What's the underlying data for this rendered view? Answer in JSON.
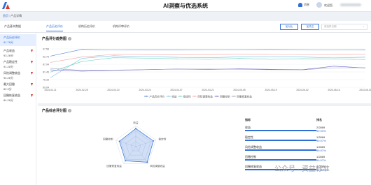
{
  "header": {
    "title": "AI洞察与优选系统",
    "notice_label": "消息",
    "welcome_label": "欢迎您,"
  },
  "breadcrumb": [
    "首页",
    "产品详情"
  ],
  "tabs": [
    "产品基本数据",
    "产品历史评价",
    "机构历史评价",
    "机构评审评价"
  ],
  "actions": {
    "btn_a": "加对比",
    "btn_b": "加关注",
    "select_placeholder": "请选择日期"
  },
  "left_list": [
    {
      "name": "产品历史评价",
      "value": "91.76分"
    },
    {
      "name": "产品收益",
      "value": "93.26分"
    },
    {
      "name": "产品稳定性",
      "value": "91.28分"
    },
    {
      "name": "风险调整收益",
      "value": "94.26分"
    },
    {
      "name": "最大回撤",
      "value": "82.3分"
    },
    {
      "name": "回撤恢复收益",
      "value": "84.26分"
    }
  ],
  "trend": {
    "heading": "产品评分趋势图",
    "help": "?",
    "colors": {
      "a": "#4a7bd0",
      "b": "#76c2e8",
      "c": "#62d0b5",
      "d": "#f4a0a0",
      "e": "#6a60c8",
      "f": "#9aa3b5"
    }
  },
  "chart_data": {
    "type": "line",
    "x": [
      "2024-02-11",
      "2024-02-25",
      "2024-03-10",
      "2024-03-24",
      "2024-04-07",
      "2024-04-21",
      "2024-05-05",
      "2024-05-19",
      "2024-06-02",
      "2024-06-16",
      "2024-06-30"
    ],
    "ylim": [
      69.04,
      97.58
    ],
    "yticks": [
      "97.58",
      "92.75",
      "87.94",
      "81.45",
      "76.33",
      "69.04"
    ],
    "series": [
      {
        "name": "产品历史评价",
        "values": [
          92.2,
          97.2,
          96.8,
          96.9,
          96.9,
          97.0,
          97.0,
          97.1,
          97.0,
          96.8,
          96.9
        ]
      },
      {
        "name": "收益",
        "values": [
          76.2,
          90.5,
          92.5,
          91.8,
          91.3,
          91.0,
          91.6,
          91.7,
          91.5,
          90.9,
          91.4
        ]
      },
      {
        "name": "稳定性",
        "values": [
          80.3,
          88.2,
          91.0,
          90.7,
          90.2,
          89.8,
          90.5,
          89.8,
          90.3,
          90.0,
          89.7
        ]
      },
      {
        "name": "风险调整收益",
        "values": [
          87.5,
          91.5,
          93.5,
          93.4,
          93.2,
          93.4,
          93.6,
          93.5,
          93.3,
          93.4,
          93.6
        ]
      },
      {
        "name": "回撤控制",
        "values": [
          82.0,
          81.0,
          81.5,
          82.1,
          82.6,
          82.3,
          82.7,
          82.4,
          82.1,
          84.7,
          83.4
        ]
      },
      {
        "name": "回撤修复收益",
        "values": [
          83.1,
          81.6,
          81.8,
          82.2,
          82.5,
          82.6,
          82.4,
          82.1,
          82.0,
          83.5,
          83.6
        ]
      }
    ],
    "legend": "bottom"
  },
  "radar": {
    "heading": "产品综合评分图",
    "help": "?",
    "labels": [
      "收益",
      "稳定性",
      "风险调整收益",
      "回撤修复收益",
      "回撤控制"
    ],
    "values": [
      0.86,
      0.88,
      0.92,
      0.84,
      0.82
    ]
  },
  "metrics": {
    "col_name": "指标",
    "col_rank": "排名",
    "rows": [
      {
        "name": "收益",
        "rank": "2/2869",
        "pct": "99.93%",
        "fraction": 0.9993
      },
      {
        "name": "稳定性",
        "rank": "1/2869",
        "pct": "99.97%",
        "fraction": 0.9997
      },
      {
        "name": "风险调整收益",
        "rank": "1/2869",
        "pct": "99.97%",
        "fraction": 0.9997
      },
      {
        "name": "回撤控制",
        "rank": "1/2869",
        "pct": "99.97%",
        "fraction": 0.9997
      },
      {
        "name": "回撤修复收益",
        "rank": "1/2869",
        "pct": "99.97%",
        "fraction": 0.9997
      }
    ]
  },
  "watermark": "公众号 · 资益标准"
}
